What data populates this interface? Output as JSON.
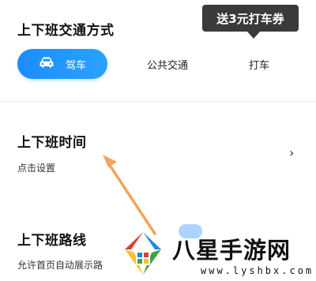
{
  "commute": {
    "title": "上下班交通方式",
    "promo": "送3元打车券",
    "tabs": [
      {
        "label": "驾车",
        "icon": "car-icon",
        "active": true
      },
      {
        "label": "公共交通",
        "active": false
      },
      {
        "label": "打车",
        "active": false
      }
    ]
  },
  "commute_time": {
    "title": "上下班时间",
    "subtitle": "点击设置",
    "chevron": "›"
  },
  "commute_route": {
    "title": "上下班路线",
    "subtitle": "允许首页自动展示路"
  },
  "watermark": {
    "title": "八星手游网",
    "url": "www.lyshbx.com"
  },
  "colors": {
    "accent": "#1a8cff",
    "promo_bg": "#3a3a3a",
    "arrow": "#f3a458"
  }
}
